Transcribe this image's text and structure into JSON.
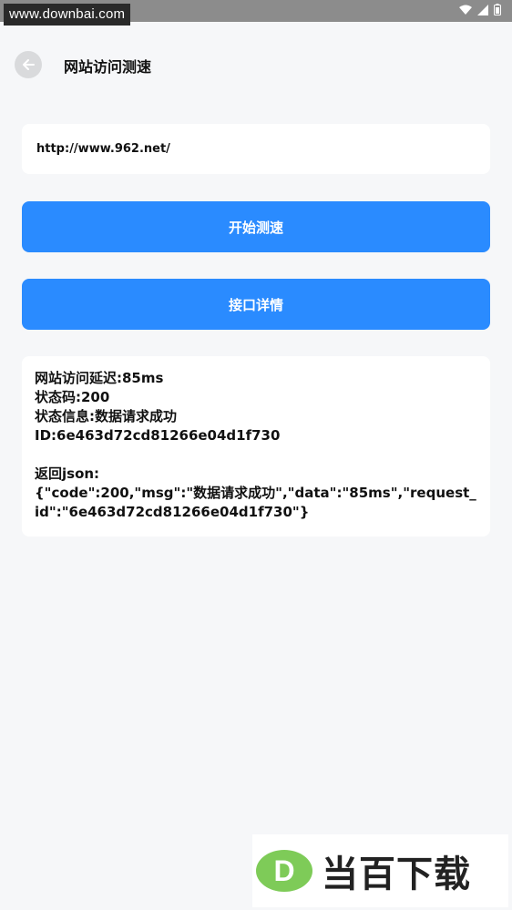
{
  "status_bar": {
    "watermark": "www.downbai.com"
  },
  "header": {
    "title": "网站访问测速",
    "back_icon": "arrow-left-icon"
  },
  "url_field": {
    "value": "http://www.962.net/"
  },
  "buttons": {
    "start_label": "开始测速",
    "detail_label": "接口详情"
  },
  "result": {
    "latency": "网站访问延迟:85ms",
    "status_code": "状态码:200",
    "status_info": "状态信息:数据请求成功",
    "id_line": "ID:6e463d72cd81266e04d1f730",
    "json_label": "返回json:",
    "json_body": "{\"code\":200,\"msg\":\"数据请求成功\",\"data\":\"85ms\",\"request_id\":\"6e463d72cd81266e04d1f730\"}"
  },
  "watermark_bottom": {
    "letter": "D",
    "text": "当百下载"
  },
  "colors": {
    "primary": "#2a8bff",
    "background": "#f6f7f9",
    "logo_green": "#7ecb58"
  }
}
